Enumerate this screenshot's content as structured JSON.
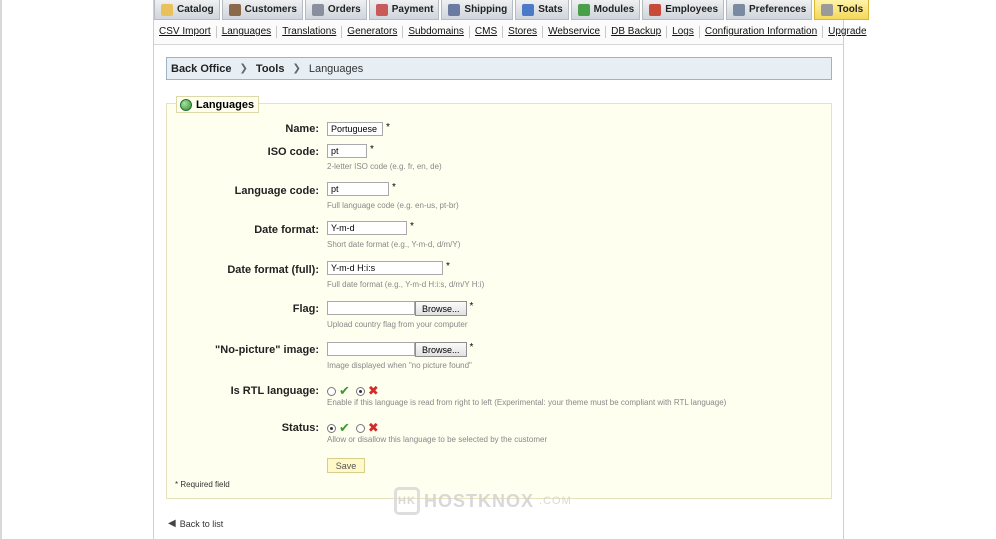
{
  "tabs": [
    {
      "label": "Catalog",
      "icon": "folder-icon",
      "color": "#e8c15a",
      "active": false
    },
    {
      "label": "Customers",
      "icon": "customer-icon",
      "color": "#8a6a4a",
      "active": false
    },
    {
      "label": "Orders",
      "icon": "cart-icon",
      "color": "#8a8fa0",
      "active": false
    },
    {
      "label": "Payment",
      "icon": "payment-icon",
      "color": "#c85a5a",
      "active": false
    },
    {
      "label": "Shipping",
      "icon": "truck-icon",
      "color": "#6a7aa0",
      "active": false
    },
    {
      "label": "Stats",
      "icon": "chart-icon",
      "color": "#4a7ac8",
      "active": false
    },
    {
      "label": "Modules",
      "icon": "puzzle-icon",
      "color": "#4aa04a",
      "active": false
    },
    {
      "label": "Employees",
      "icon": "employee-icon",
      "color": "#c84a3a",
      "active": false
    },
    {
      "label": "Preferences",
      "icon": "preferences-icon",
      "color": "#7a8aa0",
      "active": false
    },
    {
      "label": "Tools",
      "icon": "wrench-icon",
      "color": "#9a9a9a",
      "active": true
    }
  ],
  "submenu": [
    "CSV Import",
    "Languages",
    "Translations",
    "Generators",
    "Subdomains",
    "CMS",
    "Stores",
    "Webservice",
    "DB Backup",
    "Logs",
    "Configuration Information",
    "Upgrade"
  ],
  "breadcrumb": {
    "root": "Back Office",
    "section": "Tools",
    "current": "Languages"
  },
  "form": {
    "legend": "Languages",
    "name": {
      "label": "Name:",
      "value": "Portuguese"
    },
    "iso": {
      "label": "ISO code:",
      "value": "pt",
      "hint": "2-letter ISO code (e.g. fr, en, de)"
    },
    "language_code": {
      "label": "Language code:",
      "value": "pt",
      "hint": "Full language code (e.g. en-us, pt-br)"
    },
    "date_format": {
      "label": "Date format:",
      "value": "Y-m-d",
      "hint": "Short date format (e.g., Y-m-d, d/m/Y)"
    },
    "date_format_full": {
      "label": "Date format (full):",
      "value": "Y-m-d H:i:s",
      "hint": "Full date format (e.g., Y-m-d H:i:s, d/m/Y H:i)"
    },
    "flag": {
      "label": "Flag:",
      "button": "Browse...",
      "hint": "Upload country flag from your computer"
    },
    "no_picture": {
      "label": "\"No-picture\" image:",
      "button": "Browse...",
      "hint": "Image displayed when \"no picture found\""
    },
    "rtl": {
      "label": "Is RTL language:",
      "selected": "no",
      "hint": "Enable if this language is read from right to left (Experimental: your theme must be compliant with RTL language)"
    },
    "status": {
      "label": "Status:",
      "selected": "yes",
      "hint": "Allow or disallow this language to be selected by the customer"
    },
    "save_label": "Save",
    "required_mark": "*",
    "required_note": "* Required field"
  },
  "back_link": "Back to list",
  "watermark": {
    "name": "HOSTKNOX",
    "suffix": ".COM",
    "logo_text": "HK"
  }
}
